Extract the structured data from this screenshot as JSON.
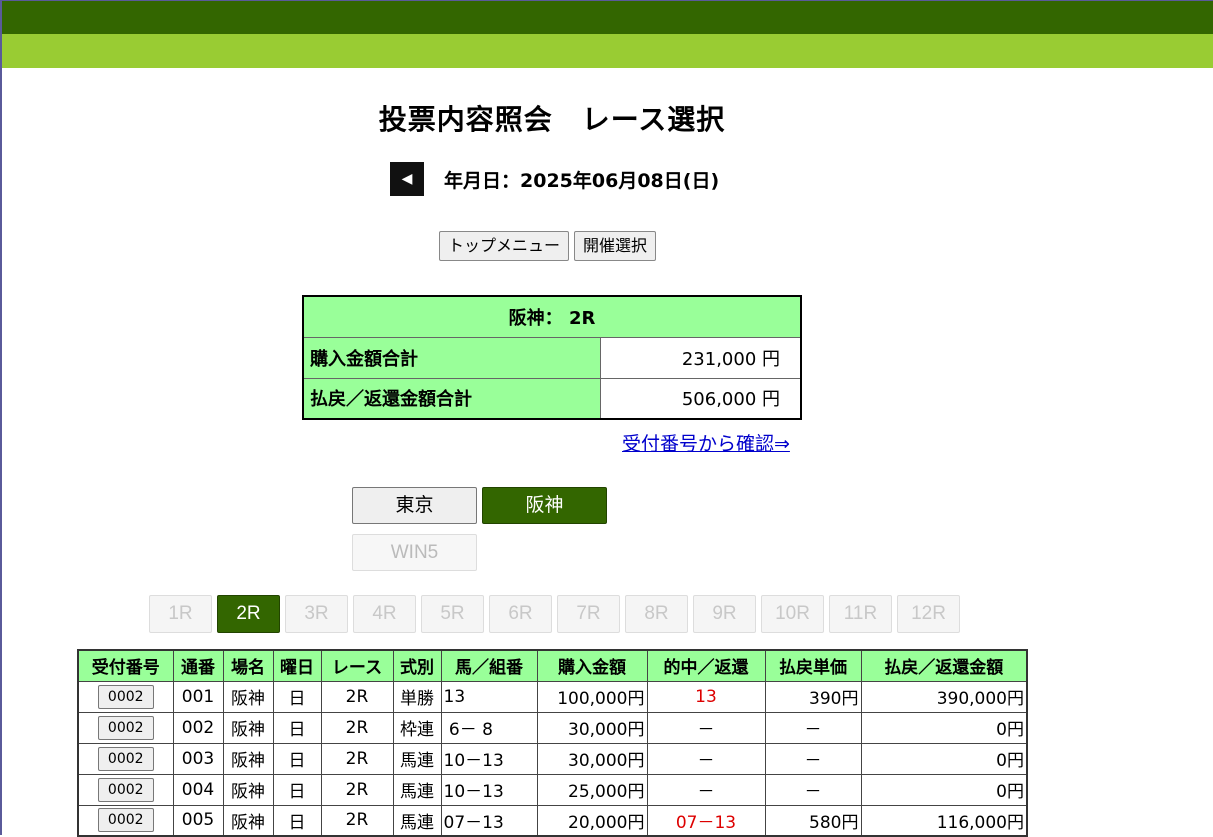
{
  "title": "投票内容照会　レース選択",
  "date": {
    "back_icon": "triangle-left-icon",
    "back_glyph": "◀",
    "label": "年月日：2025年06月08日(日)"
  },
  "menu": {
    "top_menu": "トップメニュー",
    "venue_select": "開催選択"
  },
  "summary": {
    "header": "阪神： 2R",
    "purchase_label": "購入金額合計",
    "purchase_value": "231,000 円",
    "payout_label": "払戻／返還金額合計",
    "payout_value": "506,000 円"
  },
  "link_text": "受付番号から確認⇒",
  "venues": {
    "tokyo": "東京",
    "hanshin": "阪神",
    "win5": "WIN5"
  },
  "races": [
    "1R",
    "2R",
    "3R",
    "4R",
    "5R",
    "6R",
    "7R",
    "8R",
    "9R",
    "10R",
    "11R",
    "12R"
  ],
  "active_race": "2R",
  "bets": {
    "headers": [
      "受付番号",
      "通番",
      "場名",
      "曜日",
      "レース",
      "式別",
      "馬／組番",
      "購入金額",
      "的中／返還",
      "払戻単価",
      "払戻／返還金額"
    ],
    "rows": [
      {
        "receipt": "0002",
        "seq": "001",
        "venue": "阪神",
        "day": "日",
        "race": "2R",
        "type": "単勝",
        "combo": "13",
        "amount": "100,000円",
        "hit": "13",
        "unit": "390円",
        "payout": "390,000円"
      },
      {
        "receipt": "0002",
        "seq": "002",
        "venue": "阪神",
        "day": "日",
        "race": "2R",
        "type": "枠連",
        "combo": " 6－ 8",
        "amount": "30,000円",
        "hit": "－",
        "unit": "－",
        "payout": "0円"
      },
      {
        "receipt": "0002",
        "seq": "003",
        "venue": "阪神",
        "day": "日",
        "race": "2R",
        "type": "馬連",
        "combo": "10－13",
        "amount": "30,000円",
        "hit": "－",
        "unit": "－",
        "payout": "0円"
      },
      {
        "receipt": "0002",
        "seq": "004",
        "venue": "阪神",
        "day": "日",
        "race": "2R",
        "type": "馬連",
        "combo": "10－13",
        "amount": "25,000円",
        "hit": "－",
        "unit": "－",
        "payout": "0円"
      },
      {
        "receipt": "0002",
        "seq": "005",
        "venue": "阪神",
        "day": "日",
        "race": "2R",
        "type": "馬連",
        "combo": "07－13",
        "amount": "20,000円",
        "hit": "07－13",
        "unit": "580円",
        "payout": "116,000円"
      }
    ]
  },
  "colors": {
    "dark_green": "#336600",
    "light_green": "#99cc33",
    "table_green": "#99ff99",
    "hit_red": "#dd0000"
  }
}
